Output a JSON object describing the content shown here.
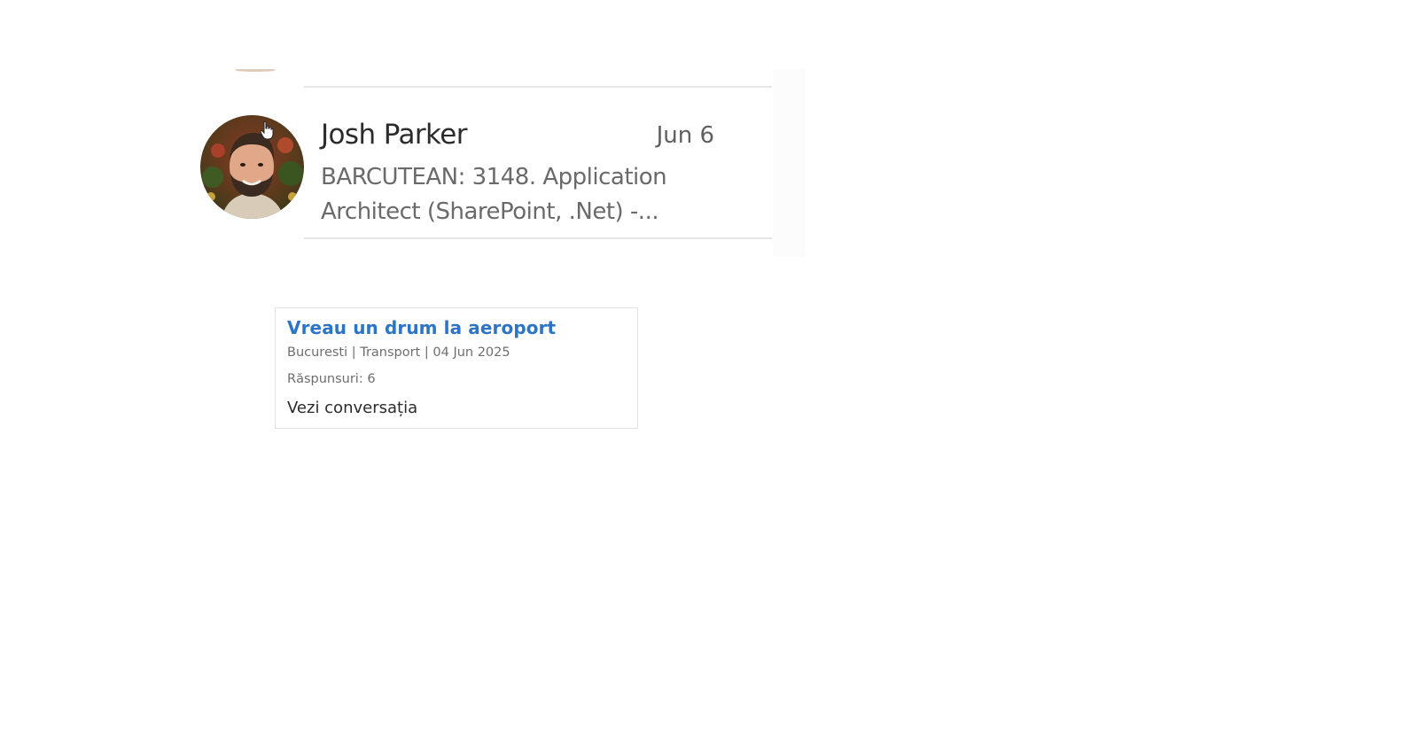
{
  "message": {
    "sender": "Josh Parker",
    "date": "Jun 6",
    "subject": "BARCUTEAN: 3148. Application Architect (SharePoint, .Net) -..."
  },
  "card": {
    "title": "Vreau un drum la aeroport",
    "meta": "Bucuresti | Transport | 04 Jun 2025",
    "replies": "Răspunsuri: 6",
    "link": "Vezi conversația"
  },
  "colors": {
    "card_title": "#2b74c6",
    "sender_text": "#2b2b2b",
    "subject_text": "#6a6a6a",
    "divider": "#e6e6e6"
  },
  "icons": {
    "cursor": "hand-pointer-icon",
    "avatar": "user-photo-avatar"
  }
}
